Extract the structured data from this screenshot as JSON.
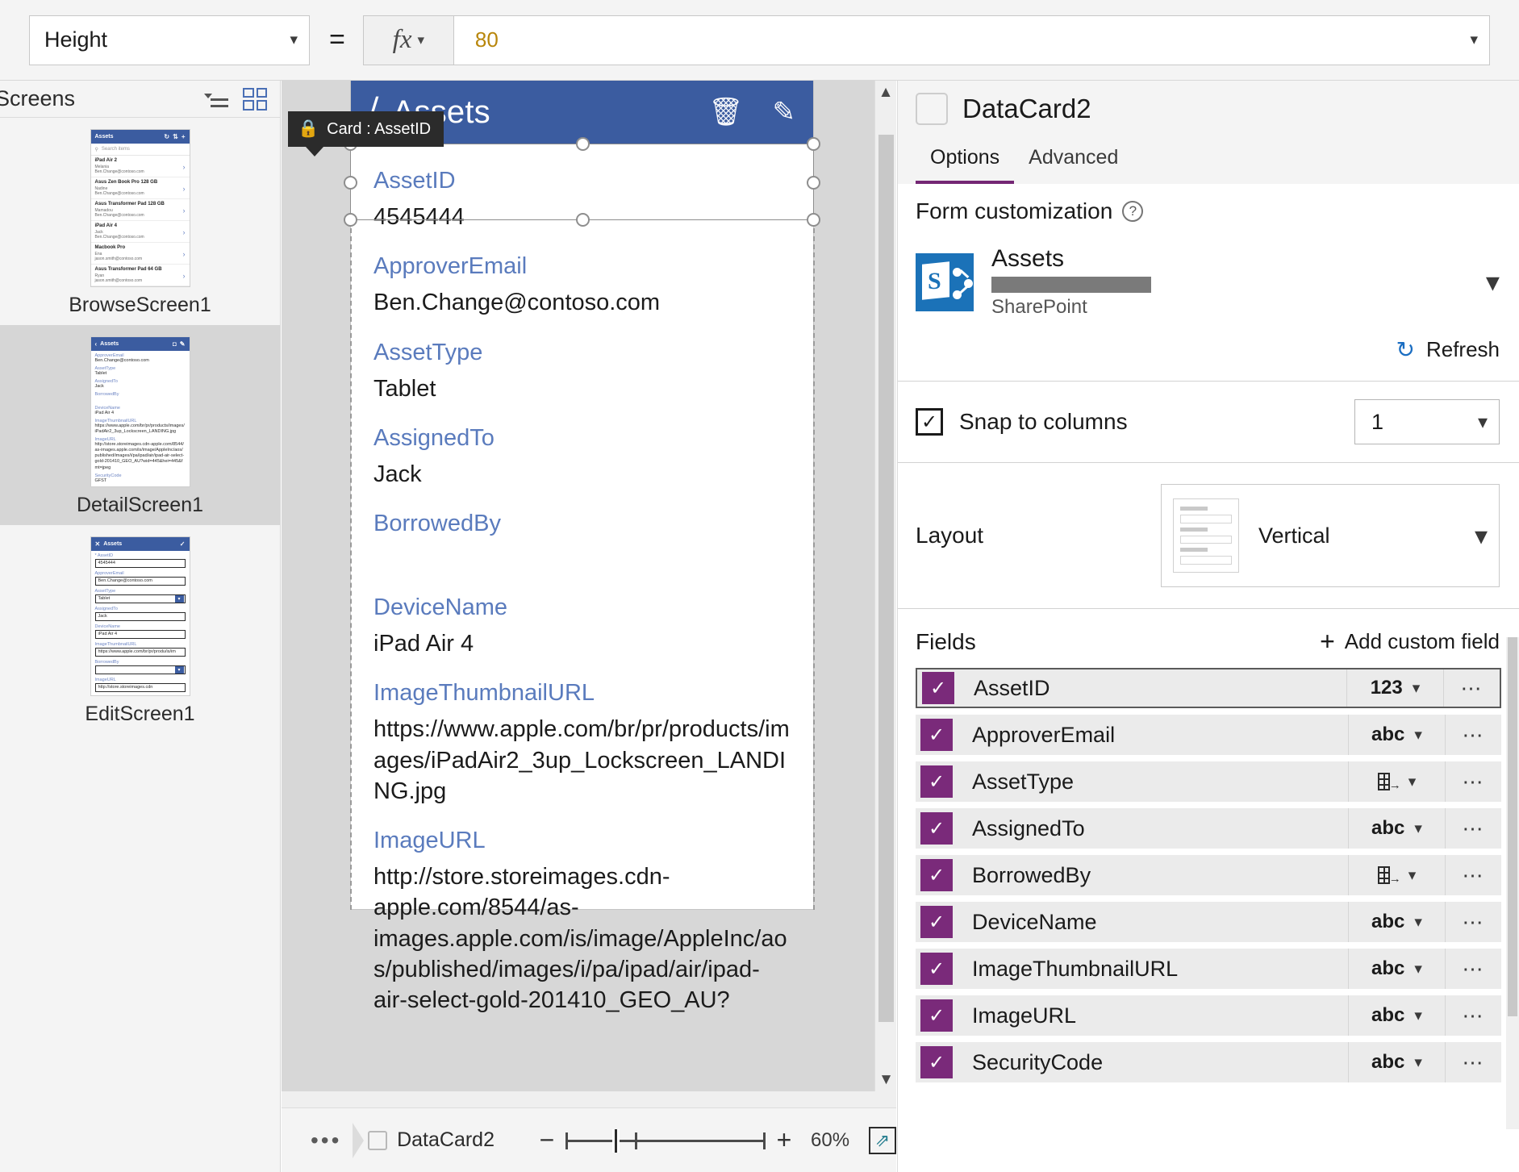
{
  "formula_bar": {
    "property": "Height",
    "equals": "=",
    "fx_label": "fx",
    "value": "80"
  },
  "screens_pane": {
    "title": "Screens",
    "icons": {
      "tree": "tree-view-icon",
      "grid": "grid-view-icon"
    },
    "screens": [
      {
        "label": "BrowseScreen1",
        "selected": false,
        "app_title": "Assets",
        "search_placeholder": "Search items",
        "rows": [
          {
            "t1": "iPad Air 2",
            "t2": "Melania",
            "t3": "Ben.Change@contoso.com"
          },
          {
            "t1": "Asus Zen Book Pro 128 GB",
            "t2": "Nadine",
            "t3": "Ben.Change@contoso.com"
          },
          {
            "t1": "Asus Transformer Pad 128 GB",
            "t2": "Mamadou",
            "t3": "Ben.Change@contoso.com"
          },
          {
            "t1": "iPad Air 4",
            "t2": "Jack",
            "t3": "Ben.Change@contoso.com"
          },
          {
            "t1": "Macbook Pro",
            "t2": "Ena",
            "t3": "jason.smith@contoso.com"
          },
          {
            "t1": "Asus Transformer Pad 64 GB",
            "t2": "Ryan",
            "t3": "jason.smith@contoso.com"
          }
        ]
      },
      {
        "label": "DetailScreen1",
        "selected": true,
        "app_title": "Assets",
        "detail_fields": [
          {
            "label": "ApproverEmail",
            "value": "Ben.Change@contoso.com"
          },
          {
            "label": "AssetType",
            "value": "Tablet"
          },
          {
            "label": "AssignedTo",
            "value": "Jack"
          },
          {
            "label": "BorrowedBy",
            "value": ""
          },
          {
            "label": "DeviceName",
            "value": "iPad Air 4"
          },
          {
            "label": "ImageThumbnailURL",
            "value": "https://www.apple.com/br/pr/products/images/iPadAir2_3up_Lockscreen_LANDING.jpg"
          },
          {
            "label": "ImageURL",
            "value": "http://store.storeimages.cdn-apple.com/8544/as-images.apple.com/is/image/AppleInc/aos/published/images/i/pa/ipad/air/ipad-air-select-gold-201410_GEO_AU?wid=445&hei=445&fmt=jpeg"
          },
          {
            "label": "SecurityCode",
            "value": "GFST"
          }
        ]
      },
      {
        "label": "EditScreen1",
        "selected": false,
        "app_title": "Assets",
        "edit_fields": [
          {
            "label": "AssetID",
            "value": "4545444",
            "required": true,
            "type": "text"
          },
          {
            "label": "ApproverEmail",
            "value": "Ben.Change@contoso.com",
            "required": false,
            "type": "text"
          },
          {
            "label": "AssetType",
            "value": "Tablet",
            "required": false,
            "type": "dropdown"
          },
          {
            "label": "AssignedTo",
            "value": "Jack",
            "required": false,
            "type": "text"
          },
          {
            "label": "DeviceName",
            "value": "iPad Air 4",
            "required": false,
            "type": "text"
          },
          {
            "label": "ImageThumbnailURL",
            "value": "https://www.apple.com/br/pr/produ/is/im",
            "required": false,
            "type": "text"
          },
          {
            "label": "BorrowedBy",
            "value": "",
            "required": false,
            "type": "dropdown"
          },
          {
            "label": "ImageURL",
            "value": "http://store.storeimages.cdn",
            "required": false,
            "type": "text"
          }
        ]
      }
    ]
  },
  "canvas": {
    "app_title": "Assets",
    "title_icons": {
      "back": "back-arrow-icon",
      "delete": "trash-icon",
      "edit": "pencil-icon"
    },
    "tooltip": {
      "icon": "lock-icon",
      "text": "Card : AssetID"
    },
    "cards": [
      {
        "label": "AssetID",
        "value": "4545444",
        "selected": true
      },
      {
        "label": "ApproverEmail",
        "value": "Ben.Change@contoso.com",
        "selected": false
      },
      {
        "label": "AssetType",
        "value": "Tablet",
        "selected": false
      },
      {
        "label": "AssignedTo",
        "value": "Jack",
        "selected": false
      },
      {
        "label": "BorrowedBy",
        "value": "",
        "selected": false
      },
      {
        "label": "DeviceName",
        "value": "iPad Air 4",
        "selected": false
      },
      {
        "label": "ImageThumbnailURL",
        "value": "https://www.apple.com/br/pr/products/images/iPadAir2_3up_Lockscreen_LANDING.jpg",
        "selected": false
      },
      {
        "label": "ImageURL",
        "value": "http://store.storeimages.cdn-apple.com/8544/as-images.apple.com/is/image/AppleInc/aos/published/images/i/pa/ipad/air/ipad-air-select-gold-201410_GEO_AU?",
        "selected": false
      }
    ]
  },
  "bottom_bar": {
    "overflow": "•••",
    "breadcrumb": "DataCard2",
    "zoom_out": "−",
    "zoom_in": "+",
    "zoom_level": "60%",
    "fit_icon": "fit-to-screen-icon"
  },
  "right_panel": {
    "title": "DataCard2",
    "tabs": [
      {
        "label": "Options",
        "active": true
      },
      {
        "label": "Advanced",
        "active": false
      }
    ],
    "form_customization": {
      "heading": "Form customization",
      "help": "?",
      "data_source": {
        "name": "Assets",
        "connector": "SharePoint",
        "icon": "sharepoint-icon",
        "site_redacted": true
      },
      "refresh_label": "Refresh"
    },
    "snap_to_columns": {
      "label": "Snap to columns",
      "checked": true,
      "columns": "1"
    },
    "layout": {
      "label": "Layout",
      "value": "Vertical",
      "preview_icon": "vertical-layout-icon"
    },
    "fields": {
      "title": "Fields",
      "add_label": "Add custom field",
      "items": [
        {
          "name": "AssetID",
          "checked": true,
          "type": "123",
          "selected": true
        },
        {
          "name": "ApproverEmail",
          "checked": true,
          "type": "abc",
          "selected": false
        },
        {
          "name": "AssetType",
          "checked": true,
          "type": "lookup",
          "selected": false
        },
        {
          "name": "AssignedTo",
          "checked": true,
          "type": "abc",
          "selected": false
        },
        {
          "name": "BorrowedBy",
          "checked": true,
          "type": "lookup",
          "selected": false
        },
        {
          "name": "DeviceName",
          "checked": true,
          "type": "abc",
          "selected": false
        },
        {
          "name": "ImageThumbnailURL",
          "checked": true,
          "type": "abc",
          "selected": false
        },
        {
          "name": "ImageURL",
          "checked": true,
          "type": "abc",
          "selected": false
        },
        {
          "name": "SecurityCode",
          "checked": true,
          "type": "abc",
          "selected": false
        }
      ]
    }
  },
  "colors": {
    "app_bar": "#3b5ca0",
    "field_label": "#5a7bbd",
    "accent_purple": "#742774",
    "checkbox_purple": "#7a2a7a",
    "formula_value": "#b8860b",
    "sharepoint_blue": "#1b72b8"
  }
}
